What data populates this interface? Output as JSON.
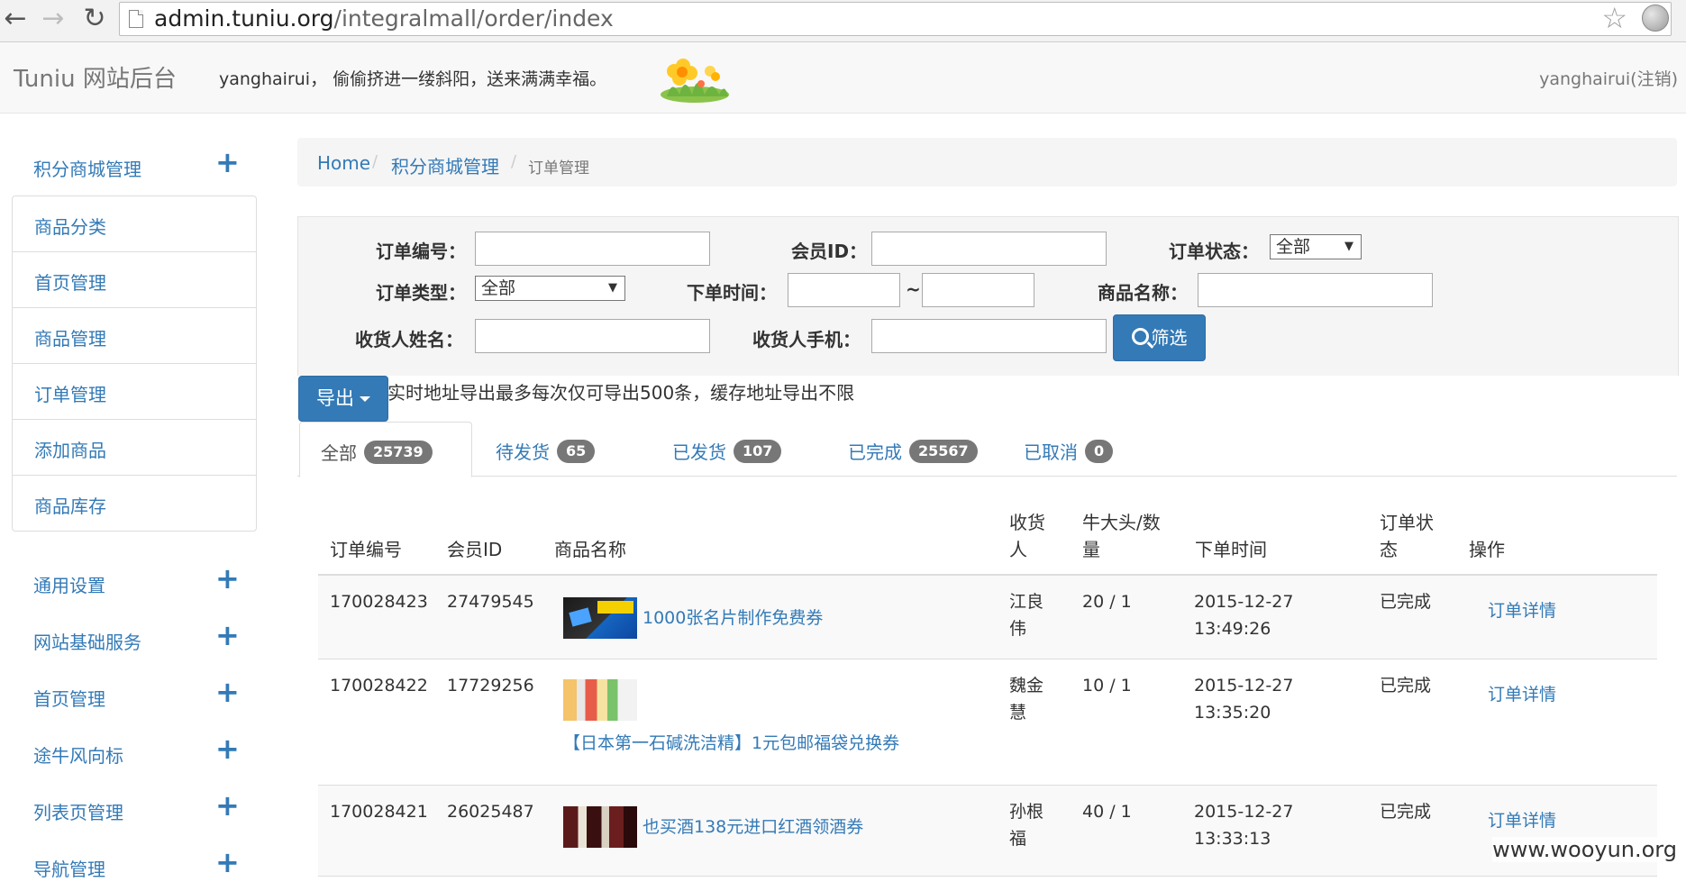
{
  "browser": {
    "url_domain": "admin.tuniu.org",
    "url_path": "/integralmall/order/index"
  },
  "header": {
    "brand": "Tuniu 网站后台",
    "greeting": "yanghairui， 偷偷挤进一缕斜阳，送来满满幸福。",
    "user_logout": "yanghairui(注销)"
  },
  "sidebar": {
    "groups": [
      {
        "label": "积分商城管理"
      },
      {
        "label": "通用设置"
      },
      {
        "label": "网站基础服务"
      },
      {
        "label": "首页管理"
      },
      {
        "label": "途牛风向标"
      },
      {
        "label": "列表页管理"
      },
      {
        "label": "导航管理"
      }
    ],
    "submenu": [
      {
        "label": "商品分类"
      },
      {
        "label": "首页管理"
      },
      {
        "label": "商品管理"
      },
      {
        "label": "订单管理"
      },
      {
        "label": "添加商品"
      },
      {
        "label": "商品库存"
      }
    ]
  },
  "breadcrumb": {
    "home": "Home",
    "level1": "积分商城管理",
    "current": "订单管理",
    "separator": "/"
  },
  "filters": {
    "order_no_label": "订单编号：",
    "member_id_label": "会员ID：",
    "order_status_label": "订单状态：",
    "order_status_value": "全部",
    "order_type_label": "订单类型：",
    "order_type_value": "全部",
    "order_time_label": "下单时间：",
    "range_sep": "~",
    "product_name_label": "商品名称：",
    "receiver_name_label": "收货人姓名：",
    "receiver_phone_label": "收货人手机：",
    "filter_button": "筛选"
  },
  "export": {
    "button": "导出",
    "note": "实时地址导出最多每次仅可导出500条，缓存地址导出不限"
  },
  "tabs": [
    {
      "label": "全部",
      "count": "25739"
    },
    {
      "label": "待发货",
      "count": "65"
    },
    {
      "label": "已发货",
      "count": "107"
    },
    {
      "label": "已完成",
      "count": "25567"
    },
    {
      "label": "已取消",
      "count": "0"
    }
  ],
  "table": {
    "headers": {
      "order_no": "订单编号",
      "member_id": "会员ID",
      "product": "商品名称",
      "receiver": "收货人",
      "points_qty": "牛大头/数量",
      "order_time": "下单时间",
      "status": "订单状态",
      "action": "操作"
    },
    "rows": [
      {
        "order_no": "170028423",
        "member_id": "27479545",
        "product": "1000张名片制作免费券",
        "receiver": "江良伟",
        "points_qty": "20 / 1",
        "date": "2015-12-27",
        "time": "13:49:26",
        "status": "已完成",
        "action": "订单详情"
      },
      {
        "order_no": "170028422",
        "member_id": "17729256",
        "product": "【日本第一石碱洗洁精】1元包邮福袋兑换券",
        "receiver": "魏金慧",
        "points_qty": "10 / 1",
        "date": "2015-12-27",
        "time": "13:35:20",
        "status": "已完成",
        "action": "订单详情"
      },
      {
        "order_no": "170028421",
        "member_id": "26025487",
        "product": "也买酒138元进口红酒领酒券",
        "receiver": "孙根福",
        "points_qty": "40 / 1",
        "date": "2015-12-27",
        "time": "13:33:13",
        "status": "已完成",
        "action": "订单详情"
      }
    ]
  },
  "watermark": "www.wooyun.org"
}
